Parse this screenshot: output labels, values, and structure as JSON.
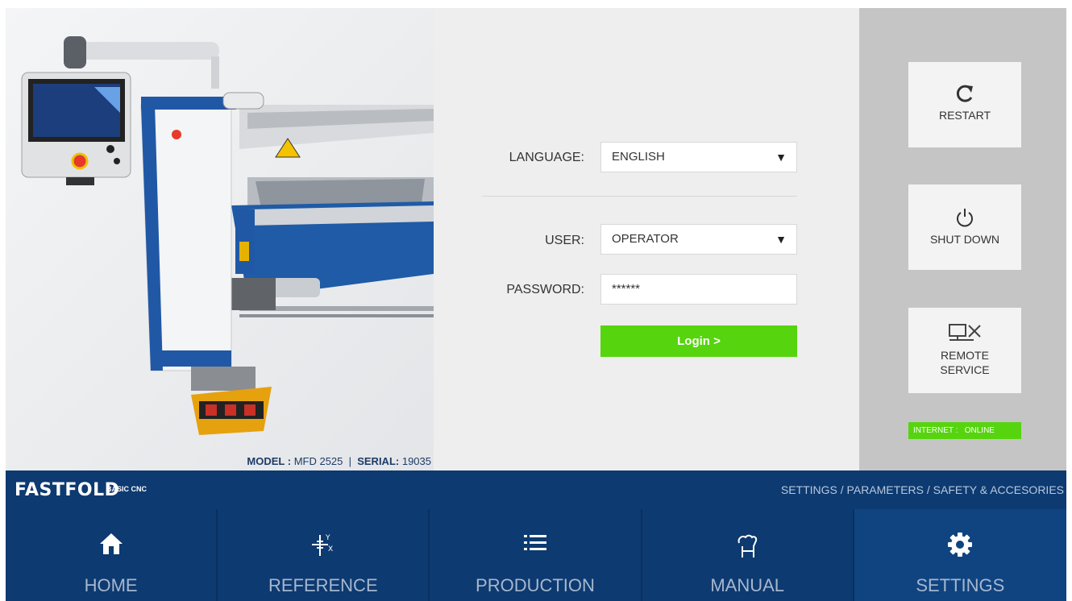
{
  "machine_panel": {
    "model_label": "MODEL : ",
    "model_value": "MFD 2525",
    "separator": "  |  ",
    "serial_label": "SERIAL: ",
    "serial_value": "19035"
  },
  "login": {
    "language_label": "LANGUAGE:",
    "language_value": "ENGLISH",
    "user_label": "USER:",
    "user_value": "OPERATOR",
    "password_label": "PASSWORD:",
    "password_value": "******",
    "login_button": "Login >",
    "login_button_color": "#56d40e"
  },
  "side_panel": {
    "restart_label": "RESTART",
    "shutdown_label": "SHUT DOWN",
    "remote_label_line1": "REMOTE",
    "remote_label_line2": "SERVICE",
    "internet_label": "INTERNET :",
    "internet_status": "ONLINE",
    "status_color": "#56d40e"
  },
  "header": {
    "brand": "FASTFOLD",
    "brand_sub": "BASIC CNC",
    "breadcrumb": "SETTINGS / PARAMETERS / SAFETY & ACCESORIES",
    "bar_color": "#0d3a70"
  },
  "nav": {
    "tabs": [
      {
        "label": "HOME",
        "icon": "home-icon"
      },
      {
        "label": "REFERENCE",
        "icon": "reference-axes-icon"
      },
      {
        "label": "PRODUCTION",
        "icon": "list-icon"
      },
      {
        "label": "MANUAL",
        "icon": "hand-icon"
      },
      {
        "label": "SETTINGS",
        "icon": "gear-icon"
      }
    ],
    "active_tab": "SETTINGS"
  }
}
